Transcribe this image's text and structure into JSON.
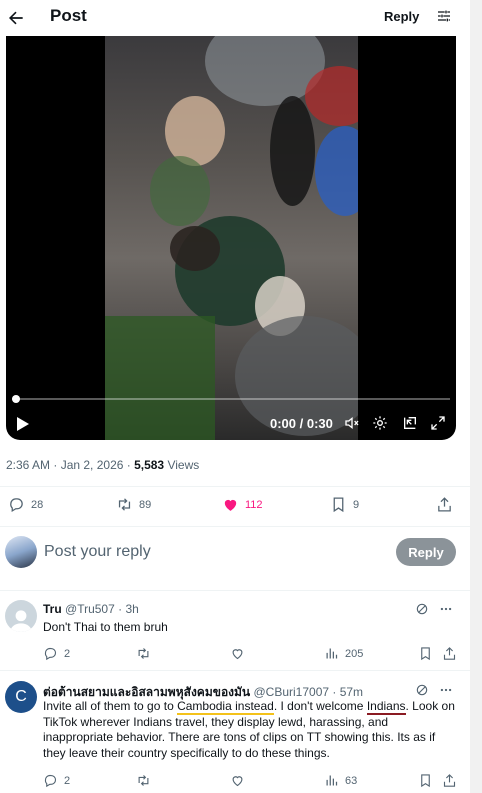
{
  "header": {
    "title": "Post",
    "reply_label": "Reply"
  },
  "video": {
    "time": "0:00 / 0:30",
    "progress": 0.0
  },
  "meta": {
    "timestamp": "2:36 AM · Jan 2, 2026 · ",
    "views_count": "5,583",
    "views_label": " Views"
  },
  "actions": {
    "replies": "28",
    "reposts": "89",
    "likes": "112",
    "bookmarks": "9"
  },
  "compose": {
    "placeholder": "Post your reply",
    "button": "Reply"
  },
  "replies": [
    {
      "avatar_initial": "",
      "name": "Tru",
      "handle": "@Tru507 · 3h",
      "text": "Don't Thai to them bruh",
      "reply_count": "2",
      "view_count": "205"
    },
    {
      "avatar_initial": "C",
      "name": "ต่อต้านสยามและอิสลามพหุสังคมของมัน",
      "handle": "@CBuri17007 · 57m",
      "text_1": "Invite all of them to go to ",
      "text_2": "Cambodia instead",
      "text_3": ". I don't welcome ",
      "text_4": "Indians",
      "text_5": ". Look on TikTok wherever Indians travel, they display lewd, harassing, and inappropriate behavior. There are tons of clips on TT showing this. Its as if they leave their country specifically to do these things.",
      "reply_count": "2",
      "view_count": "63"
    }
  ],
  "colors": {
    "like": "#f91880",
    "muted": "#536471",
    "underline_yellow": "#f4c21a",
    "underline_red": "#8a1a22"
  }
}
